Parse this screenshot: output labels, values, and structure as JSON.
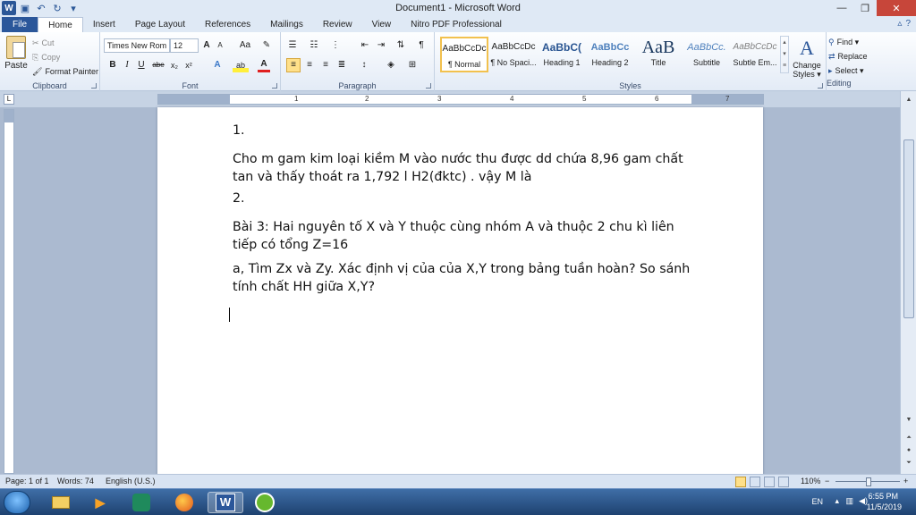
{
  "window": {
    "title": "Document1 - Microsoft Word",
    "app_icon": "W"
  },
  "tabs": [
    "File",
    "Home",
    "Insert",
    "Page Layout",
    "References",
    "Mailings",
    "Review",
    "View",
    "Nitro PDF Professional"
  ],
  "clipboard": {
    "paste": "Paste",
    "cut": "Cut",
    "copy": "Copy",
    "format_painter": "Format Painter",
    "label": "Clipboard"
  },
  "font": {
    "name": "Times New Rom",
    "size": "12",
    "label": "Font",
    "bold": "B",
    "italic": "I",
    "underline": "U",
    "strike": "abe",
    "subscript": "x₂",
    "superscript": "x²",
    "grow": "A",
    "shrink": "A",
    "case": "Aa",
    "font_color": "A",
    "highlight": "ab"
  },
  "paragraph": {
    "label": "Paragraph",
    "show_marks": "¶"
  },
  "styles": {
    "label": "Styles",
    "items": [
      {
        "sample": "AaBbCcDc",
        "name": "¶ Normal"
      },
      {
        "sample": "AaBbCcDc",
        "name": "¶ No Spaci..."
      },
      {
        "sample": "AaBbC(",
        "name": "Heading 1"
      },
      {
        "sample": "AaBbCc",
        "name": "Heading 2"
      },
      {
        "sample": "AaB",
        "name": "Title"
      },
      {
        "sample": "AaBbCc.",
        "name": "Subtitle"
      },
      {
        "sample": "AaBbCcDc",
        "name": "Subtle Em..."
      }
    ],
    "change_styles_line1": "Change",
    "change_styles_line2": "Styles ▾",
    "change_styles_icon": "A"
  },
  "editing": {
    "label": "Editing",
    "find": "Find ▾",
    "replace": "Replace",
    "select": "Select ▾"
  },
  "ruler_numbers": [
    "1",
    "2",
    "3",
    "4",
    "5",
    "6",
    "7"
  ],
  "document": {
    "paragraphs": [
      "1.",
      "Cho m gam kim loại kiềm M vào nước thu được dd chứa 8,96 gam chất tan và thấy thoát ra 1,792 l H2(đktc) . vậy M là",
      "2.",
      "Bài 3: Hai nguyên tố X và Y thuộc cùng nhóm A và thuộc 2 chu kì liên tiếp có tổng Z=16",
      "a, Tìm Zx và Zy. Xác định vị của của X,Y trong bảng tuần hoàn? So sánh tính chất HH giữa X,Y?"
    ]
  },
  "status": {
    "page": "Page: 1 of 1",
    "words": "Words: 74",
    "language": "English (U.S.)",
    "zoom": "110%",
    "zoom_minus": "−",
    "zoom_plus": "+"
  },
  "taskbar": {
    "lang": "EN",
    "time": "6:55 PM",
    "date": "11/5/2019",
    "word_label": "W"
  }
}
